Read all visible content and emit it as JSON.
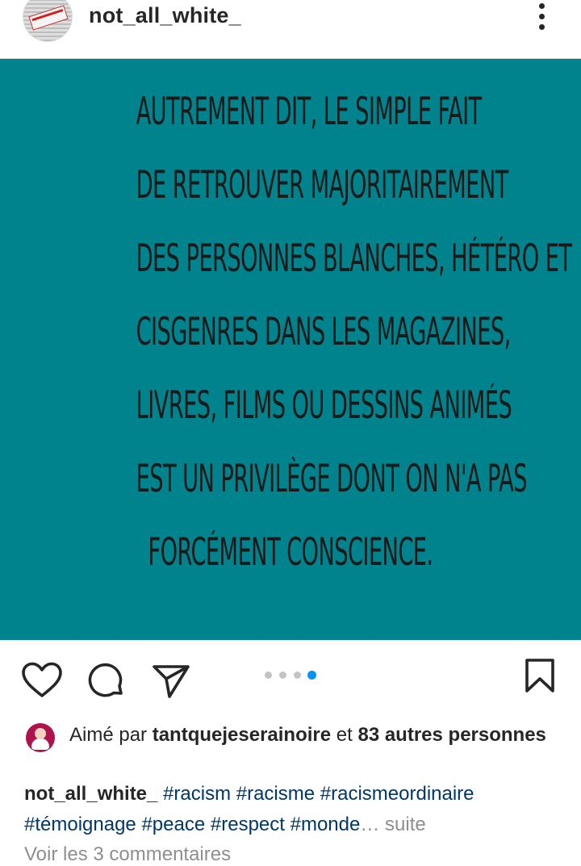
{
  "header": {
    "username": "not_all_white_",
    "more_icon": "more-vertical-icon"
  },
  "post": {
    "background_color": "#00838c",
    "text_lines": [
      "Autrement dit, le simple fait",
      "de retrouver majoritairement",
      "des personnes blanches, hétéro et",
      "cisgenres dans les magazines,",
      "livres, films ou dessins animés",
      "est un privilège dont on n'a pas",
      "forcément conscience."
    ]
  },
  "actions": {
    "like_icon": "heart-icon",
    "comment_icon": "comment-icon",
    "share_icon": "send-icon",
    "save_icon": "bookmark-icon",
    "carousel": {
      "total": 4,
      "active_index": 3,
      "active_color": "#0095f6"
    }
  },
  "likes": {
    "prefix": "Aimé par ",
    "user": "tantquejeserainoire",
    "middle": " et ",
    "others": "83 autres personnes"
  },
  "caption": {
    "author": "not_all_white_",
    "hashtags": [
      "#racism",
      "#racisme",
      "#racismeordinaire",
      "#témoignage",
      "#peace",
      "#respect",
      "#monde"
    ],
    "ellipsis": "…",
    "more_label": "suite"
  },
  "comments": {
    "label": "Voir les 3 commentaires"
  }
}
